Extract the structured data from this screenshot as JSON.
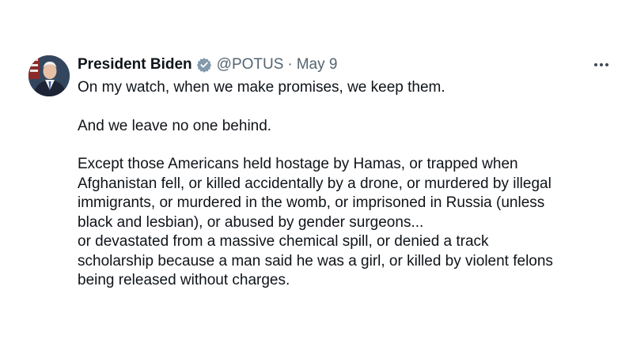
{
  "tweet": {
    "display_name": "President Biden",
    "verified_icon": "verified-badge-icon",
    "handle": "@POTUS",
    "separator": "·",
    "date": "May 9",
    "more_icon": "more-options-icon",
    "paragraph1": "On my watch, when we make promises, we keep them.",
    "paragraph2": "And we leave no one behind.",
    "paragraph3_lines": [
      "Except those Americans held hostage by Hamas, or trapped when",
      "Afghanistan fell, or killed accidentally by a drone, or murdered by illegal",
      "immigrants, or murdered in the womb, or imprisoned in Russia (unless",
      "black and lesbian), or abused by gender surgeons..."
    ],
    "paragraph4_lines": [
      "or devastated from a massive chemical spill, or denied a track",
      "scholarship because a man said he was a girl, or killed by violent felons",
      "being released without charges."
    ]
  },
  "colors": {
    "text": "#0f1419",
    "secondary": "#536471",
    "verified": "#829aab"
  }
}
